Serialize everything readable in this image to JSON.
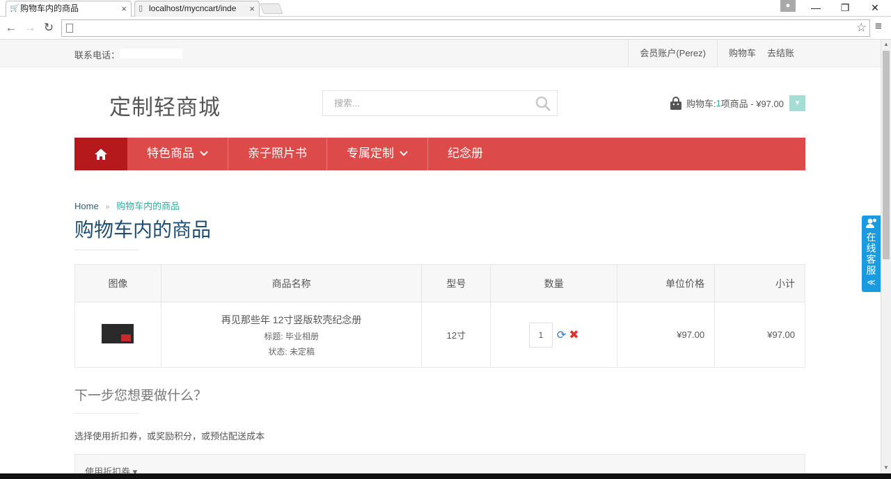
{
  "browser": {
    "tabs": [
      {
        "title": "购物车内的商品",
        "active": true
      },
      {
        "title": "localhost/mycncart/inde",
        "active": false
      }
    ],
    "close_glyph": "×",
    "minimize_glyph": "—",
    "restore_glyph": "❐",
    "close_window_glyph": "✕",
    "back_glyph": "←",
    "forward_glyph": "→",
    "reload_glyph": "↻",
    "star_glyph": "☆",
    "menu_glyph": "≡",
    "profile_glyph": "●"
  },
  "topbar": {
    "phone_label": "联系电话：",
    "links": {
      "account": "会员账户(Perez)",
      "cart": "购物车",
      "checkout": "去结账"
    }
  },
  "header": {
    "logo": "定制轻商城",
    "search_placeholder": "搜索...",
    "cart_prefix": "购物车: ",
    "cart_count": "1",
    "cart_suffix": "项商品 - ¥97.00",
    "cart_toggle_glyph": "▾"
  },
  "nav": {
    "items": [
      {
        "label": "特色商品",
        "has_dropdown": true
      },
      {
        "label": "亲子照片书",
        "has_dropdown": false
      },
      {
        "label": "专属定制",
        "has_dropdown": true
      },
      {
        "label": "纪念册",
        "has_dropdown": false
      }
    ],
    "chevron": "⌄"
  },
  "breadcrumb": {
    "home": "Home",
    "sep": "»",
    "current": "购物车内的商品"
  },
  "page_title": "购物车内的商品",
  "cart_table": {
    "headers": {
      "image": "图像",
      "name": "商品名称",
      "model": "型号",
      "quantity": "数量",
      "unit_price": "单位价格",
      "total": "小计"
    },
    "rows": [
      {
        "name": "再见那些年 12寸竖版软壳纪念册",
        "option1": "标题: 毕业相册",
        "option2": "状态: 未定稿",
        "model": "12寸",
        "quantity": "1",
        "unit_price": "¥97.00",
        "total": "¥97.00"
      }
    ],
    "refresh_glyph": "⟳",
    "remove_glyph": "✖"
  },
  "next_steps": {
    "title": "下一步您想要做什么？",
    "description": "选择使用折扣券，或奖励积分，或预估配送成本",
    "coupon_label": "使用折扣券 ▾"
  },
  "service_widget": {
    "label_chars": [
      "在",
      "线",
      "客",
      "服"
    ],
    "arrows": "≪"
  },
  "colors": {
    "nav_red": "#dc4a49",
    "nav_home": "#b5191b",
    "accent_teal": "#38a89d",
    "title_blue": "#1f4e72",
    "service_blue": "#1a9be0"
  }
}
